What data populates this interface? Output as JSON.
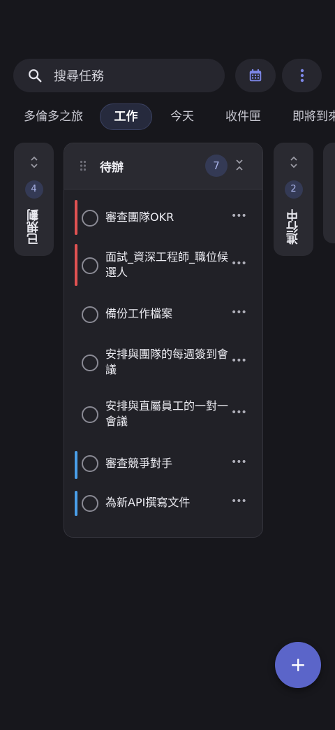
{
  "search": {
    "placeholder": "搜尋任務",
    "icon": "search-icon"
  },
  "toolbar": {
    "calendar_icon": "calendar-icon",
    "menu_icon": "more-vertical-icon"
  },
  "tabs": [
    {
      "label": "多倫多之旅",
      "active": false
    },
    {
      "label": "工作",
      "active": true
    },
    {
      "label": "今天",
      "active": false
    },
    {
      "label": "收件匣",
      "active": false
    },
    {
      "label": "即將到來",
      "active": false
    }
  ],
  "columns": {
    "planned": {
      "title": "已規劃",
      "count": "4"
    },
    "todo": {
      "title": "待辦",
      "count": "7"
    },
    "in_progress": {
      "title": "進行中",
      "count": "2"
    }
  },
  "tasks": [
    {
      "label": "審查團隊OKR",
      "priority_color": "#e05252"
    },
    {
      "label": "面試_資深工程師_職位候選人",
      "priority_color": "#e05252"
    },
    {
      "label": "備份工作檔案",
      "priority_color": ""
    },
    {
      "label": "安排與團隊的每週簽到會議",
      "priority_color": ""
    },
    {
      "label": "安排與直屬員工的一對一會議",
      "priority_color": ""
    },
    {
      "label": "審查競爭對手",
      "priority_color": "#4a9ee8"
    },
    {
      "label": "為新API撰寫文件",
      "priority_color": "#4a9ee8"
    }
  ],
  "more_label": "•••",
  "fab": {
    "icon": "plus-icon"
  },
  "colors": {
    "accent": "#5b65c9",
    "background": "#17171c",
    "high_priority": "#e05252",
    "low_priority": "#4a9ee8"
  }
}
